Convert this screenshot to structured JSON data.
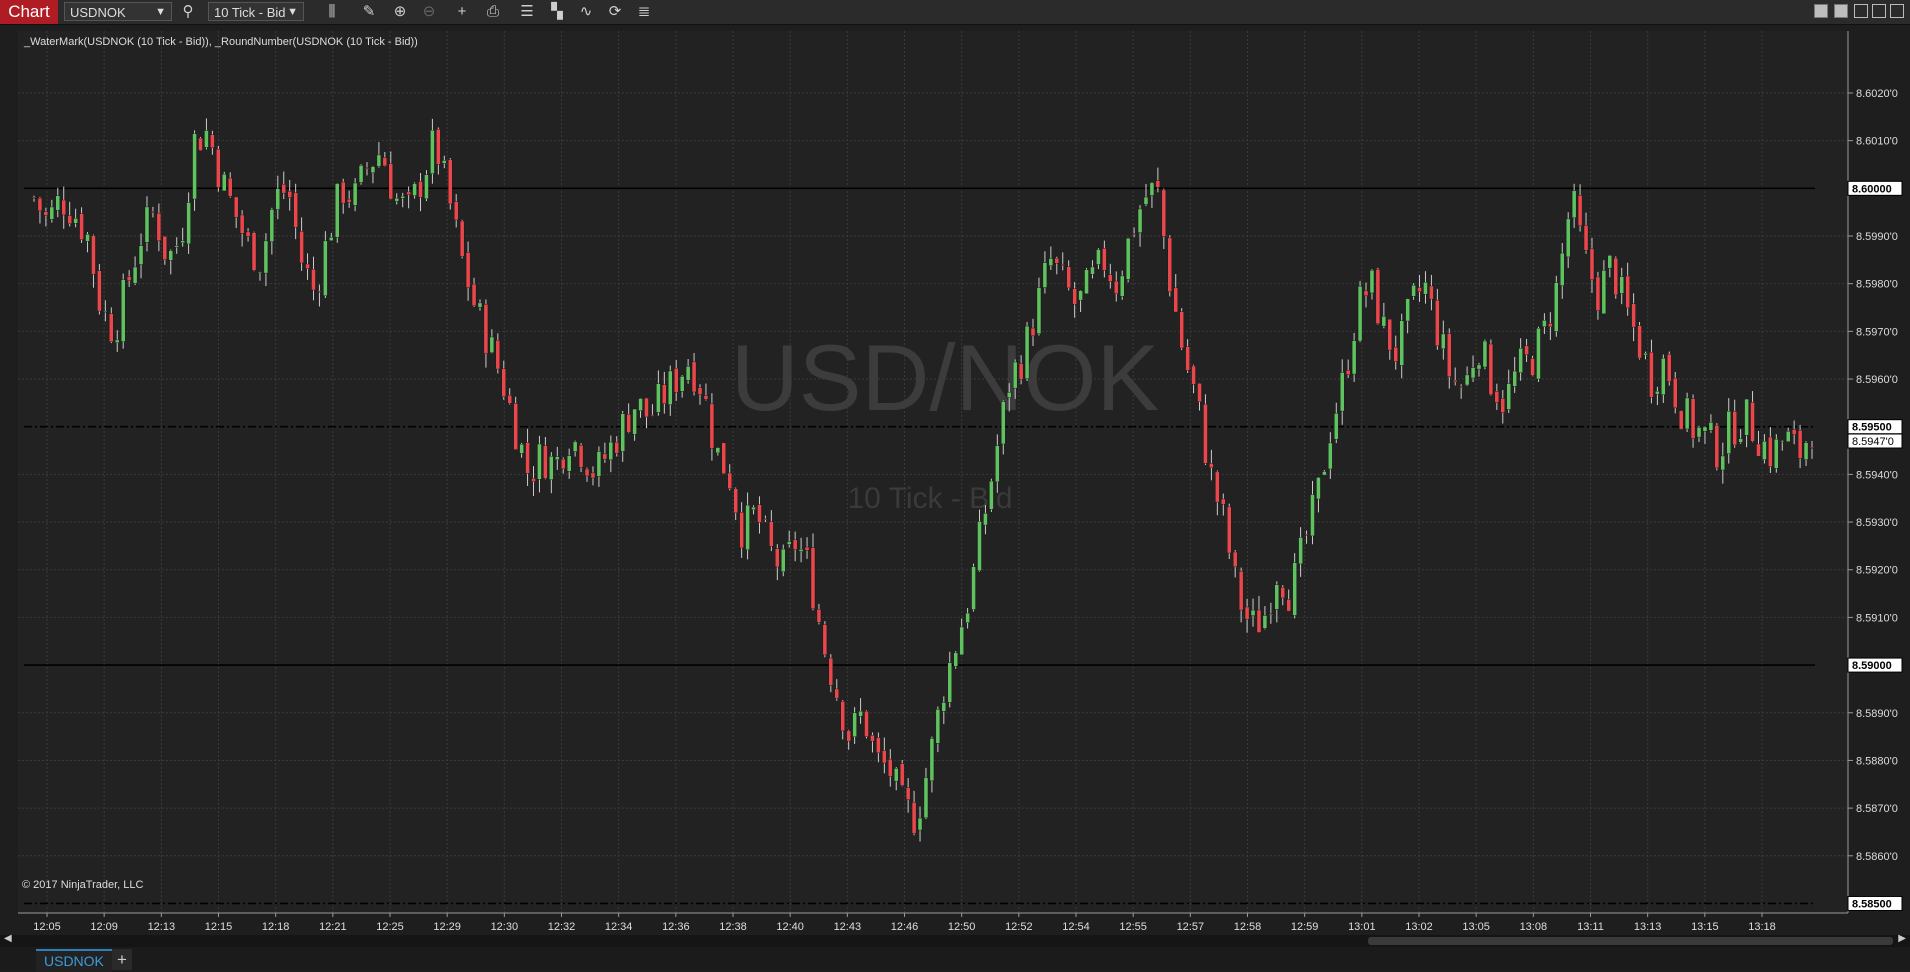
{
  "toolbar": {
    "chart_label": "Chart",
    "instrument": "USDNOK",
    "interval": "10 Tick - Bid"
  },
  "indicator_label": "_WaterMark(USDNOK (10 Tick - Bid)), _RoundNumber(USDNOK (10 Tick - Bid))",
  "watermark": {
    "symbol": "USD/NOK",
    "interval": "10 Tick - Bid"
  },
  "copyright": "© 2017 NinjaTrader, LLC",
  "tab": {
    "label": "USDNOK",
    "add_label": "+"
  },
  "colors": {
    "up": "#5fc15f",
    "down": "#e8474c",
    "background": "#1e1e1e",
    "grid": "#3a3a3a"
  },
  "chart_data": {
    "type": "candlestick",
    "ylim": [
      8.5848,
      8.6033
    ],
    "y_ticks": [
      "8.6020'0",
      "8.6010'0",
      "8.5990'0",
      "8.5980'0",
      "8.5970'0",
      "8.5960'0",
      "8.5940'0",
      "8.5930'0",
      "8.5920'0",
      "8.5910'0",
      "8.5890'0",
      "8.5880'0",
      "8.5870'0",
      "8.5860'0"
    ],
    "y_tick_values": [
      8.602,
      8.601,
      8.599,
      8.598,
      8.597,
      8.596,
      8.594,
      8.593,
      8.592,
      8.591,
      8.589,
      8.588,
      8.587,
      8.586
    ],
    "round_levels": [
      {
        "label": "8.60000",
        "value": 8.6,
        "style": "solid"
      },
      {
        "label": "8.59500",
        "value": 8.595,
        "style": "dashdot"
      },
      {
        "label": "8.59000",
        "value": 8.59,
        "style": "solid"
      },
      {
        "label": "8.58500",
        "value": 8.585,
        "style": "dashdot"
      }
    ],
    "last_price": {
      "label": "8.5947'0",
      "value": 8.5947
    },
    "x_labels": [
      "12:05",
      "12:09",
      "12:13",
      "12:15",
      "12:18",
      "12:21",
      "12:25",
      "12:29",
      "12:30",
      "12:32",
      "12:34",
      "12:36",
      "12:38",
      "12:40",
      "12:43",
      "12:46",
      "12:50",
      "12:52",
      "12:54",
      "12:55",
      "12:57",
      "12:58",
      "12:59",
      "13:01",
      "13:02",
      "13:05",
      "13:08",
      "13:11",
      "13:13",
      "13:15",
      "13:18"
    ],
    "close_path": [
      8.5998,
      8.5993,
      8.5998,
      8.5995,
      8.599,
      8.5975,
      8.597,
      8.598,
      8.599,
      8.5995,
      8.5985,
      8.599,
      8.601,
      8.6012,
      8.6002,
      8.5995,
      8.5988,
      8.5985,
      8.5998,
      8.6,
      8.5985,
      8.5978,
      8.599,
      8.6,
      8.5998,
      8.6005,
      8.6008,
      8.5998,
      8.5995,
      8.6002,
      8.601,
      8.5998,
      8.5985,
      8.5975,
      8.5968,
      8.596,
      8.595,
      8.594,
      8.5944,
      8.5942,
      8.5948,
      8.5945,
      8.594,
      8.5945,
      8.595,
      8.5955,
      8.5952,
      8.5956,
      8.596,
      8.5964,
      8.5958,
      8.5945,
      8.594,
      8.5928,
      8.5932,
      8.5924,
      8.592,
      8.5926,
      8.592,
      8.5905,
      8.5895,
      8.5885,
      8.589,
      8.588,
      8.5878,
      8.587,
      8.5868,
      8.588,
      8.5895,
      8.5905,
      8.5915,
      8.593,
      8.5945,
      8.596,
      8.5965,
      8.5975,
      8.5985,
      8.598,
      8.5975,
      8.598,
      8.5985,
      8.598,
      8.599,
      8.5998,
      8.6,
      8.598,
      8.5965,
      8.5955,
      8.594,
      8.593,
      8.5915,
      8.5908,
      8.591,
      8.592,
      8.5915,
      8.5925,
      8.5935,
      8.595,
      8.596,
      8.5975,
      8.598,
      8.597,
      8.5965,
      8.5975,
      8.598,
      8.597,
      8.596,
      8.5958,
      8.5968,
      8.596,
      8.5955,
      8.5962,
      8.5964,
      8.597,
      8.598,
      8.5998,
      8.5985,
      8.5978,
      8.5984,
      8.5975,
      8.5968,
      8.596,
      8.5964,
      8.5955,
      8.595,
      8.5948,
      8.5945,
      8.595,
      8.5952,
      8.5948,
      8.5944,
      8.5948,
      8.5944,
      8.595
    ]
  }
}
